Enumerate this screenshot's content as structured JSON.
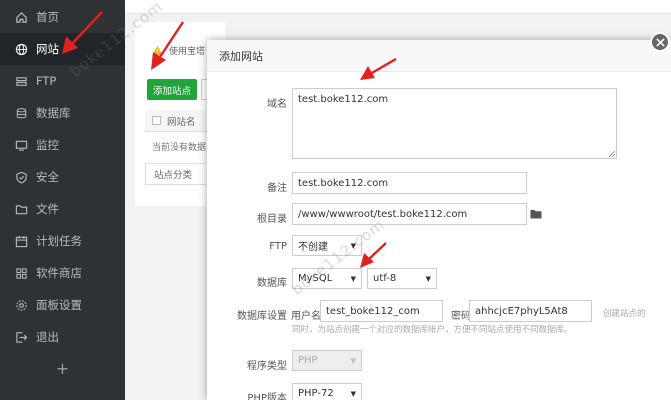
{
  "sidebar": {
    "items": [
      {
        "label": "首页",
        "icon": "home-icon"
      },
      {
        "label": "网站",
        "icon": "globe-icon",
        "active": true
      },
      {
        "label": "FTP",
        "icon": "ftp-icon"
      },
      {
        "label": "数据库",
        "icon": "database-icon"
      },
      {
        "label": "监控",
        "icon": "monitor-icon"
      },
      {
        "label": "安全",
        "icon": "shield-icon"
      },
      {
        "label": "文件",
        "icon": "folder-icon"
      },
      {
        "label": "计划任务",
        "icon": "calendar-icon"
      },
      {
        "label": "软件商店",
        "icon": "grid-icon"
      },
      {
        "label": "面板设置",
        "icon": "settings-icon"
      },
      {
        "label": "退出",
        "icon": "logout-icon"
      }
    ],
    "add_symbol": "+"
  },
  "background": {
    "warning": "使用宝塔",
    "add_site_button": "添加站点",
    "table_header": "网站名",
    "empty_text": "当前没有数据",
    "category_label": "站点分类"
  },
  "modal": {
    "title": "添加网站",
    "domain": {
      "label": "域名",
      "value": "test.boke112.com"
    },
    "remark": {
      "label": "备注",
      "value": "test.boke112.com"
    },
    "root": {
      "label": "根目录",
      "value": "/www/wwwroot/test.boke112.com"
    },
    "ftp": {
      "label": "FTP",
      "value": "不创建"
    },
    "database": {
      "label": "数据库",
      "type": "MySQL",
      "charset": "utf-8"
    },
    "db_settings": {
      "label": "数据库设置",
      "username_label": "用户名",
      "username": "test_boke112_com",
      "password_label": "密码",
      "password": "ahhcjcE7phyL5At8",
      "side_hint": "创建站点的",
      "hint": "同时，为站点创建一个对应的数据库帐户，方便不同站点使用不同数据库。"
    },
    "program_type": {
      "label": "程序类型",
      "value": "PHP"
    },
    "php_version": {
      "label": "PHP版本",
      "value": "PHP-72"
    }
  },
  "watermark": "boke112.com",
  "colors": {
    "sidebar_bg": "#2e3235",
    "accent_green": "#20a53a",
    "annotation_red": "#e0221e"
  }
}
